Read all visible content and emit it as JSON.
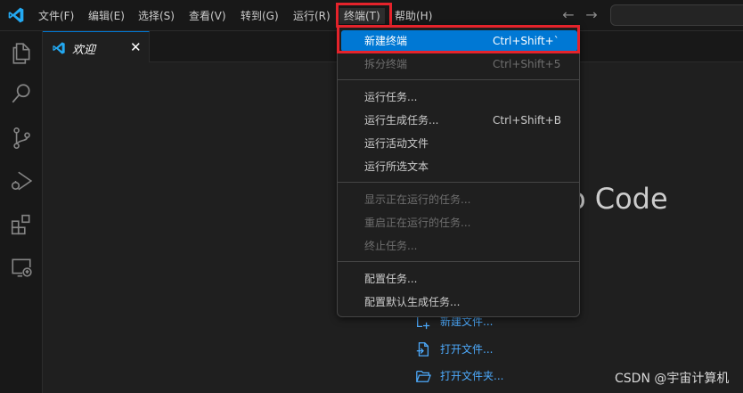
{
  "menubar": {
    "items": [
      "文件(F)",
      "编辑(E)",
      "选择(S)",
      "查看(V)",
      "转到(G)",
      "运行(R)",
      "终端(T)",
      "帮助(H)"
    ],
    "active": "终端(T)"
  },
  "tab": {
    "label": "欢迎",
    "close": "✕"
  },
  "welcome": {
    "title_fragment": "o Code",
    "start_items": [
      "新建文件...",
      "打开文件...",
      "打开文件夹..."
    ]
  },
  "terminal_menu": {
    "groups": [
      [
        {
          "label": "新建终端",
          "shortcut": "Ctrl+Shift+`",
          "state": "highlighted"
        },
        {
          "label": "拆分终端",
          "shortcut": "Ctrl+Shift+5",
          "state": "disabled"
        }
      ],
      [
        {
          "label": "运行任务...",
          "shortcut": "",
          "state": "enabled"
        },
        {
          "label": "运行生成任务...",
          "shortcut": "Ctrl+Shift+B",
          "state": "enabled"
        },
        {
          "label": "运行活动文件",
          "shortcut": "",
          "state": "enabled"
        },
        {
          "label": "运行所选文本",
          "shortcut": "",
          "state": "enabled"
        }
      ],
      [
        {
          "label": "显示正在运行的任务...",
          "shortcut": "",
          "state": "disabled"
        },
        {
          "label": "重启正在运行的任务...",
          "shortcut": "",
          "state": "disabled"
        },
        {
          "label": "终止任务...",
          "shortcut": "",
          "state": "disabled"
        }
      ],
      [
        {
          "label": "配置任务...",
          "shortcut": "",
          "state": "enabled"
        },
        {
          "label": "配置默认生成任务...",
          "shortcut": "",
          "state": "enabled"
        }
      ]
    ]
  },
  "watermark": "CSDN @宇宙计算机",
  "colors": {
    "accent": "#0078d4",
    "highlight_border": "#e5232b",
    "link": "#4daafc",
    "vscode_blue": "#23a9f2"
  },
  "icons": {
    "activity": [
      "explorer-icon",
      "search-icon",
      "source-control-icon",
      "run-debug-icon",
      "extensions-icon",
      "remote-explorer-icon"
    ],
    "nav": [
      "arrow-left-icon",
      "arrow-right-icon"
    ]
  }
}
